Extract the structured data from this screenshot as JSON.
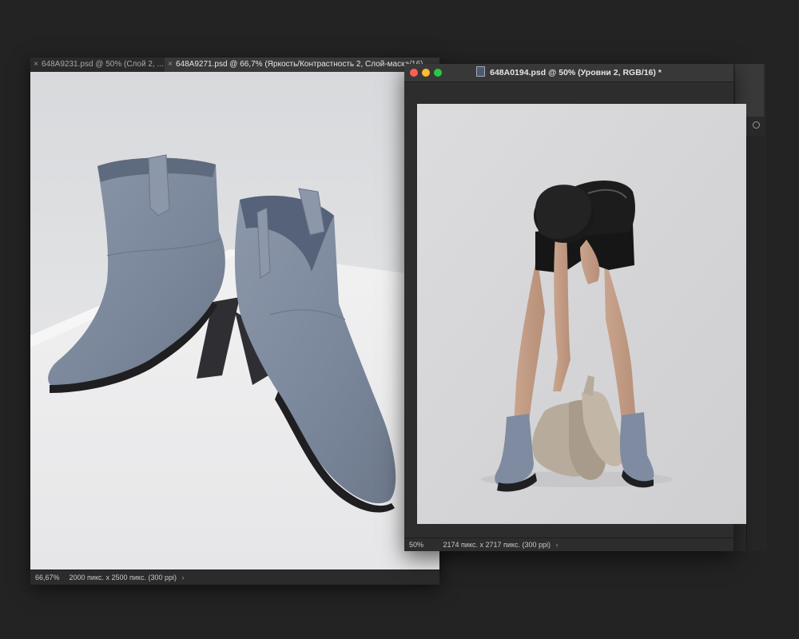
{
  "back_window": {
    "tabs": [
      {
        "label": "648A9231.psd @ 50% (Слой 2, ...",
        "active": false
      },
      {
        "label": "648A9271.psd @ 66,7% (Яркость/Контрастность 2, Слой-маска/16)",
        "active": true
      }
    ],
    "status": {
      "zoom": "66,67%",
      "dimensions": "2000 пикс. x 2500 пикс. (300 ppi)",
      "chevron": "›"
    },
    "image": {
      "subject": "pair of grey suede western ankle boots on white cube",
      "icon": "boots-photo"
    }
  },
  "front_window": {
    "title": "648A0194.psd @ 50% (Уровни 2, RGB/16) *",
    "status": {
      "zoom": "50%",
      "dimensions": "2174 пикс. x 2717 пикс. (300 ppi)",
      "chevron": "›"
    },
    "image": {
      "subject": "model holding beige boots, wearing grey boots",
      "icon": "model-photo"
    }
  },
  "colors": {
    "background": "#232323",
    "boot_suede": "#7e8ba0",
    "traffic_close": "#fe5f57",
    "traffic_min": "#febc2e",
    "traffic_max": "#28c840"
  }
}
